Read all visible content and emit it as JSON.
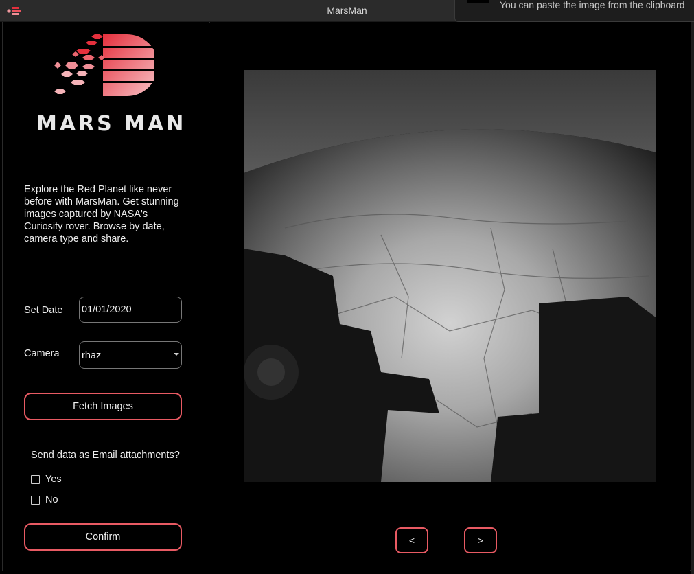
{
  "window": {
    "title": "MarsMan"
  },
  "toast": {
    "text": "You can paste the image from the clipboard"
  },
  "sidebar": {
    "brand": "MARS MAN",
    "description": "Explore the Red Planet like never before with MarsMan. Get stunning images captured by NASA's Curiosity rover. Browse by date, camera type and share.",
    "date_label": "Set Date",
    "date_value": "01/01/2020",
    "camera_label": "Camera",
    "camera_value": "rhaz",
    "fetch_label": "Fetch Images",
    "email_question": "Send data as Email attachments?",
    "options": [
      {
        "label": "Yes",
        "checked": false
      },
      {
        "label": "No",
        "checked": false
      }
    ],
    "confirm_label": "Confirm"
  },
  "main": {
    "prev_label": "<",
    "next_label": ">",
    "image_icon": "mars-surface-photo"
  },
  "colors": {
    "accent": "#e85a63",
    "background": "#000000",
    "logo_red": "#e5303d",
    "logo_pink": "#f7b8bd"
  }
}
